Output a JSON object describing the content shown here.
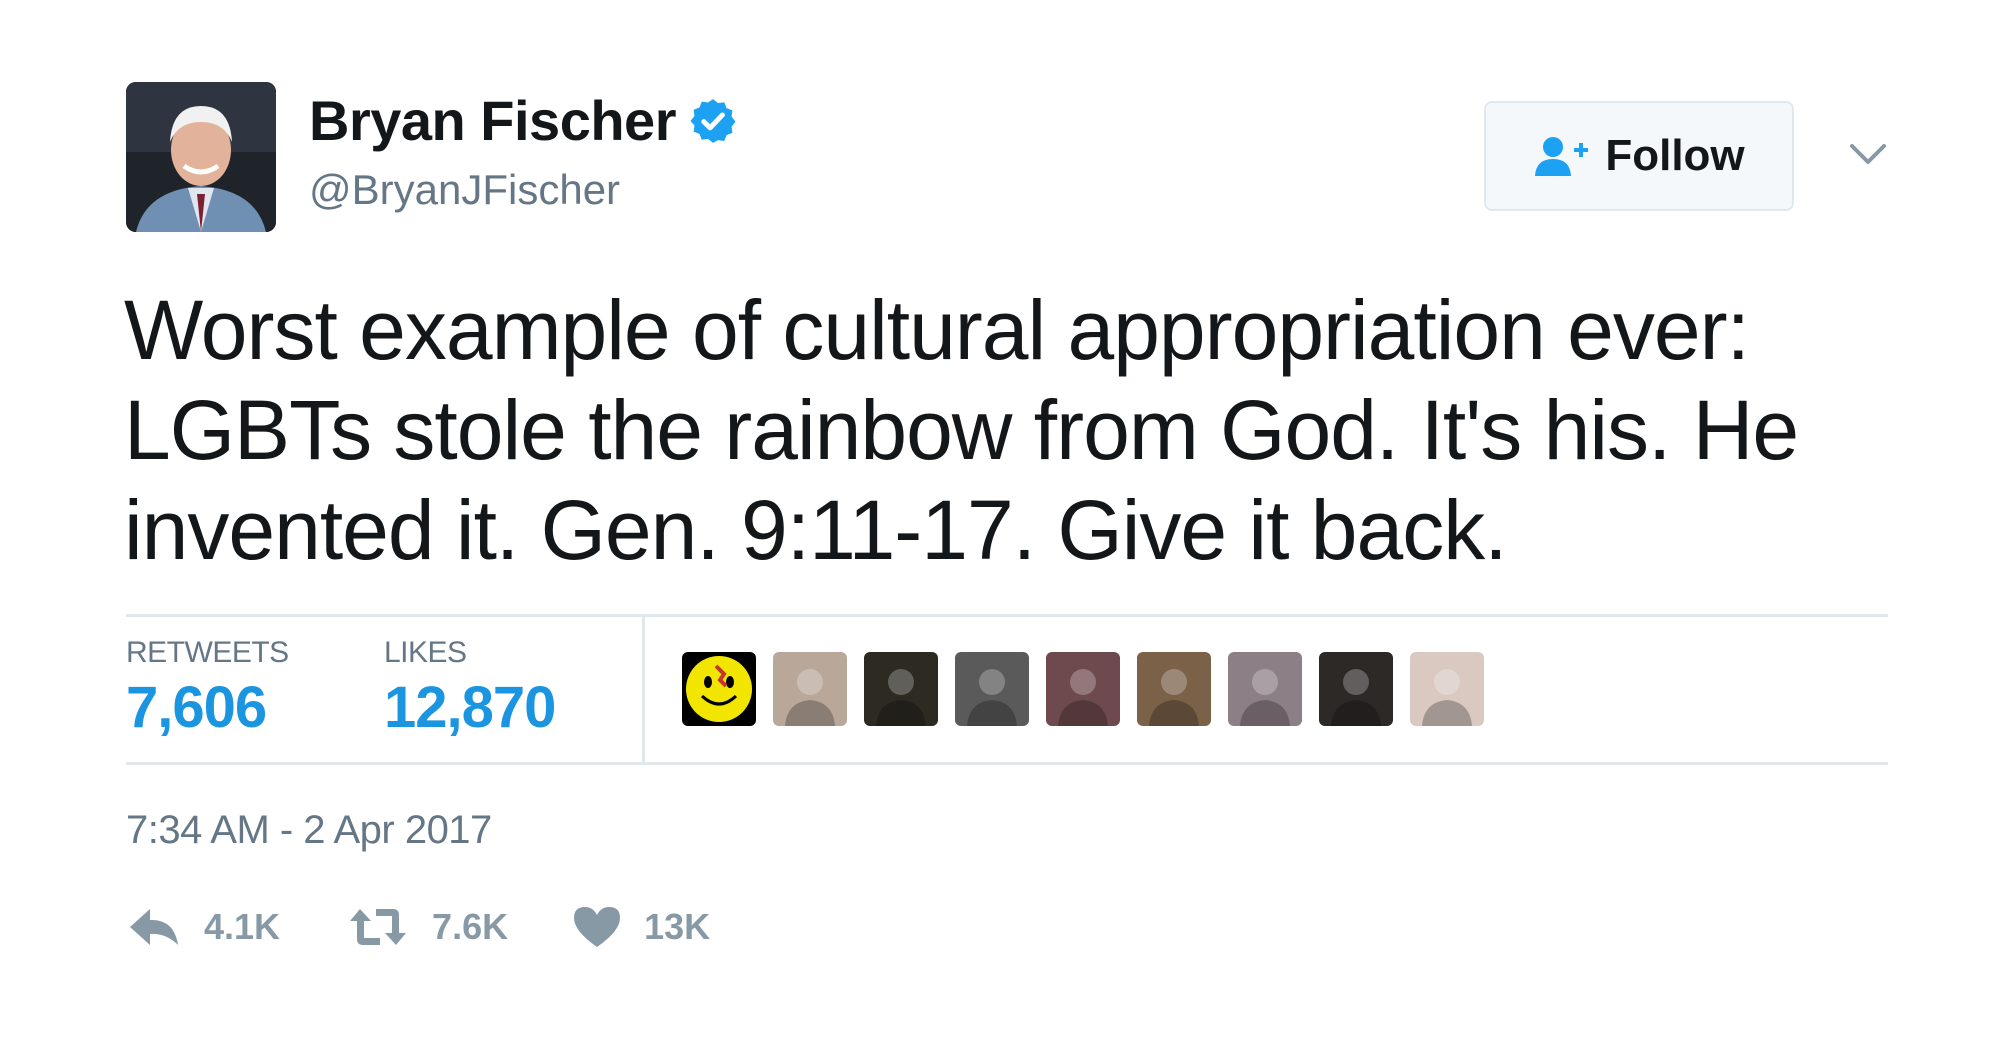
{
  "user": {
    "display_name": "Bryan Fischer",
    "handle": "@BryanJFischer",
    "verified": true,
    "avatar_icon": "user-photo"
  },
  "follow": {
    "label": "Follow",
    "icon": "follow-user-icon"
  },
  "tweet": {
    "text_lines": [
      "Worst example of cultural appropriation ever:",
      "LGBTs stole the rainbow from God. It's his. He",
      "invented it. Gen. 9:11-17. Give it back."
    ]
  },
  "stats": {
    "retweets_label": "RETWEETS",
    "retweets_value": "7,606",
    "likes_label": "LIKES",
    "likes_value": "12,870"
  },
  "likers": [
    {
      "kind": "smiley",
      "color": "#f2e600"
    },
    {
      "kind": "photo",
      "color": "#b9a79a"
    },
    {
      "kind": "photo",
      "color": "#2d2a22"
    },
    {
      "kind": "photo",
      "color": "#5a5a5a"
    },
    {
      "kind": "photo",
      "color": "#6e4a4f"
    },
    {
      "kind": "photo",
      "color": "#7a6148"
    },
    {
      "kind": "photo",
      "color": "#8c7f86"
    },
    {
      "kind": "photo",
      "color": "#2c2927"
    },
    {
      "kind": "photo",
      "color": "#d9c9c1"
    }
  ],
  "timestamp": "7:34 AM - 2 Apr 2017",
  "actions": {
    "reply_count": "4.1K",
    "retweet_count": "7.6K",
    "like_count": "13K"
  },
  "colors": {
    "accent": "#1b95e0",
    "verified": "#1da1f2",
    "text": "#14171a",
    "muted": "#657786",
    "action": "#8899a6",
    "divider": "#e1e8ed"
  }
}
